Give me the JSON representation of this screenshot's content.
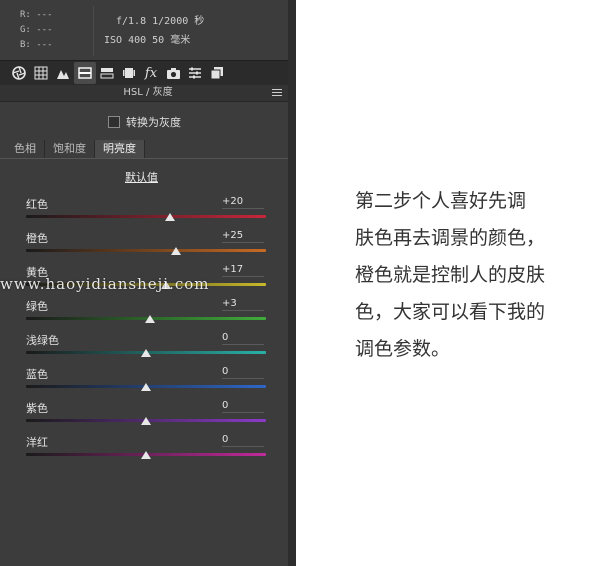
{
  "readout": {
    "r": "R: ---",
    "g": "G: ---",
    "b": "B: ---"
  },
  "camera": {
    "line1": "f/1.8  1/2000 秒",
    "line2": "ISO 400  50 毫米"
  },
  "toolbar": {
    "fx_label": "fx"
  },
  "panel": {
    "header": "HSL / 灰度",
    "convert_gray_label": "转换为灰度",
    "default_link": "默认值"
  },
  "tabs": [
    {
      "label": "色相",
      "active": false
    },
    {
      "label": "饱和度",
      "active": false
    },
    {
      "label": "明亮度",
      "active": true
    }
  ],
  "sliders": [
    {
      "label": "红色",
      "value": "+20",
      "level": 20,
      "color": "#c8263a"
    },
    {
      "label": "橙色",
      "value": "+25",
      "level": 25,
      "color": "#c86a22"
    },
    {
      "label": "黄色",
      "value": "+17",
      "level": 17,
      "color": "#c8b82a"
    },
    {
      "label": "绿色",
      "value": "+3",
      "level": 3,
      "color": "#3fae3a"
    },
    {
      "label": "浅绿色",
      "value": "0",
      "level": 0,
      "color": "#28b0a8"
    },
    {
      "label": "蓝色",
      "value": "0",
      "level": 0,
      "color": "#2e66c8"
    },
    {
      "label": "紫色",
      "value": "0",
      "level": 0,
      "color": "#8a3ac8"
    },
    {
      "label": "洋红",
      "value": "0",
      "level": 0,
      "color": "#c02a9a"
    }
  ],
  "watermark": "www.haoyidiansheji.com",
  "caption": {
    "lines": [
      "第二步个人喜好先调",
      "肤色再去调景的颜色，",
      "橙色就是控制人的皮肤",
      "色，大家可以看下我的",
      "调色参数。"
    ]
  }
}
